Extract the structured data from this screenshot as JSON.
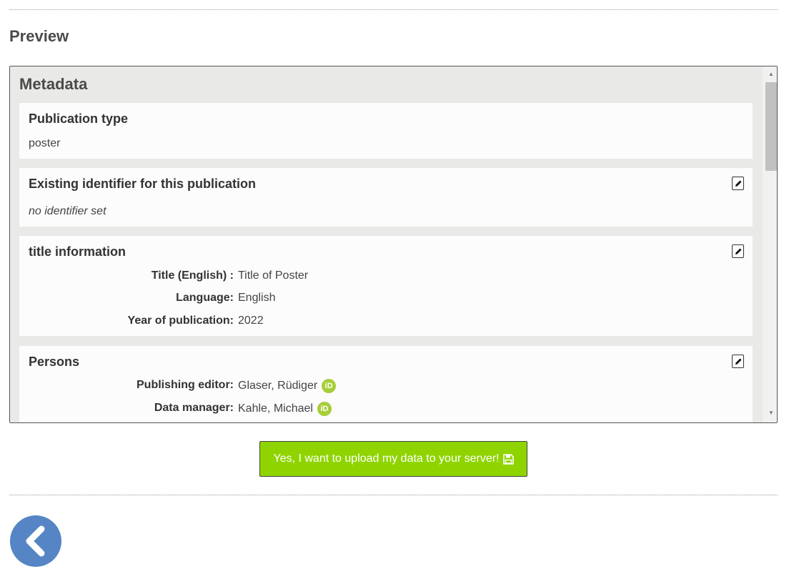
{
  "preview": {
    "heading": "Preview"
  },
  "metadata": {
    "heading": "Metadata",
    "publication_type": {
      "title": "Publication type",
      "value": "poster"
    },
    "identifier": {
      "title": "Existing identifier for this publication",
      "value": "no identifier set"
    },
    "title_information": {
      "title": "title information",
      "rows": [
        {
          "label": "Title  (English) :",
          "value": "Title of Poster"
        },
        {
          "label": "Language:",
          "value": "English"
        },
        {
          "label": "Year of publication:",
          "value": "2022"
        }
      ]
    },
    "persons": {
      "title": "Persons",
      "rows": [
        {
          "label": "Publishing editor:",
          "value": "Glaser, Rüdiger",
          "orcid": "iD"
        },
        {
          "label": "Data manager:",
          "value": "Kahle, Michael",
          "orcid": "iD"
        }
      ]
    }
  },
  "upload_button": {
    "label": "Yes, I want to upload my data to your server!"
  },
  "colors": {
    "accent_green": "#8fd400",
    "back_blue": "#5585c5",
    "orcid_green": "#a6ce39"
  },
  "icons": [
    "edit-pencil-icon",
    "orcid-icon",
    "floppy-disk-icon",
    "chevron-left-icon"
  ]
}
